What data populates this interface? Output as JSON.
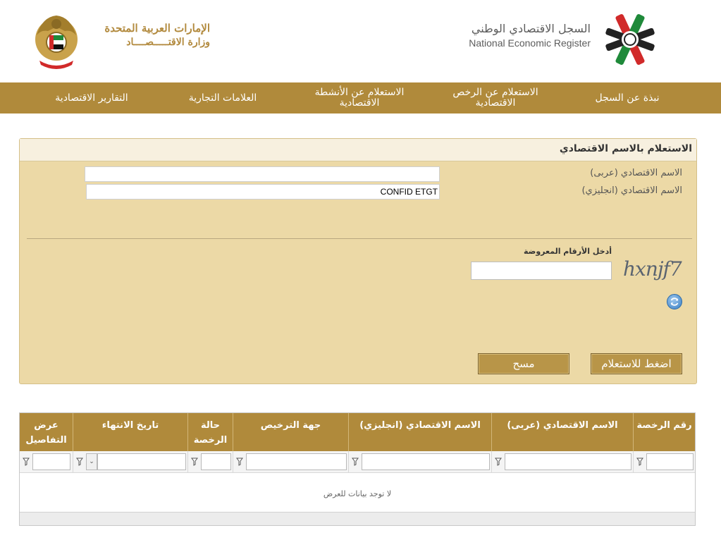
{
  "header": {
    "ministry_line1": "الإمارات العربية المتحدة",
    "ministry_line2": "وزارة الاقتـــــصــــاد",
    "register_name_ar": "السجل الاقتصادي الوطني",
    "register_name_en": "National Economic Register"
  },
  "nav": {
    "items": [
      {
        "label": "نبذة عن السجل"
      },
      {
        "label": "الاستعلام عن الرخص الاقتصادية"
      },
      {
        "label": "الاستعلام عن الأنشطة الاقتصادية"
      },
      {
        "label": "العلامات التجارية"
      },
      {
        "label": "التقارير الاقتصادية"
      }
    ]
  },
  "search": {
    "title": "الاستعلام بالاسم الاقتصادي",
    "arabic_name_label": "الاسم الاقتصادي (عربى)",
    "arabic_name_value": "",
    "english_name_label": "الاسم الاقتصادي (انجليزي)",
    "english_name_value": "CONFID ETGT",
    "captcha_label": "أدخل الأرقام المعروضة",
    "captcha_text": "hxnjf7",
    "captcha_value": "",
    "submit_label": "اضغط للاستعلام",
    "clear_label": "مسح"
  },
  "grid": {
    "columns": [
      {
        "label": "رقم الرخصة"
      },
      {
        "label": "الاسم الاقتصادي (عربى)"
      },
      {
        "label": "الاسم الاقتصادي (انجليزي)"
      },
      {
        "label": "جهة الترخيص"
      },
      {
        "label": "حالة الرخصة"
      },
      {
        "label": "تاريخ الانتهاء"
      },
      {
        "label": "عرض التفاصيل"
      }
    ],
    "empty_message": "لا توجد بيانات للعرض"
  },
  "colors": {
    "brand_gold": "#b08a3b",
    "panel_bg": "#ecd9a6",
    "button": "#b89548"
  }
}
